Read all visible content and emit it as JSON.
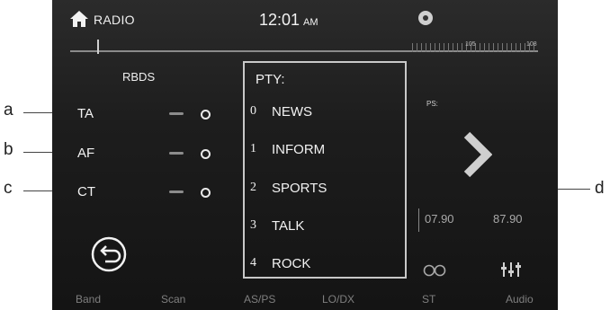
{
  "header": {
    "title": "RADIO",
    "time": "12:01",
    "ampm": "AM"
  },
  "scale": {
    "mark1": "105",
    "mark2": "108"
  },
  "rbds": {
    "title": "RBDS",
    "options": [
      {
        "label": "TA"
      },
      {
        "label": "AF"
      },
      {
        "label": "CT"
      }
    ]
  },
  "pty": {
    "title": "PTY:",
    "items": [
      {
        "num": "0",
        "name": "NEWS"
      },
      {
        "num": "1",
        "name": "INFORM"
      },
      {
        "num": "2",
        "name": "SPORTS"
      },
      {
        "num": "3",
        "name": "TALK"
      },
      {
        "num": "4",
        "name": "ROCK"
      }
    ]
  },
  "right": {
    "ps_label": "PS:",
    "freq_left": "07.90",
    "freq_right": "87.90"
  },
  "bottom_bar": [
    "Band",
    "Scan",
    "AS/PS",
    "LO/DX",
    "ST",
    "Audio"
  ],
  "callouts": {
    "a": "a",
    "b": "b",
    "c": "c",
    "d": "d"
  }
}
